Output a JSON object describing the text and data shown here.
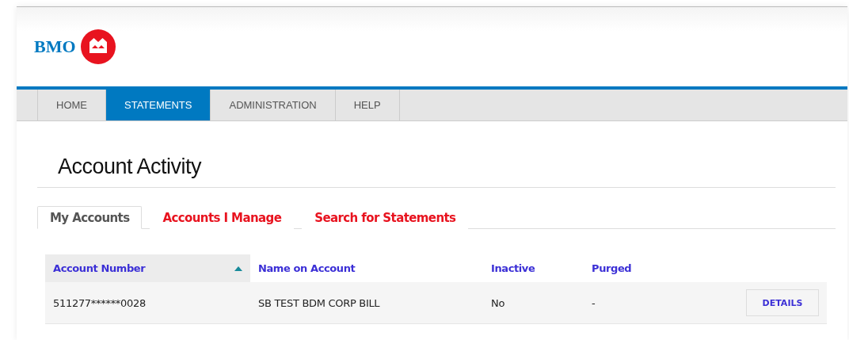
{
  "brand": {
    "name": "BMO"
  },
  "nav": [
    {
      "label": "HOME",
      "selected": false
    },
    {
      "label": "STATEMENTS",
      "selected": true
    },
    {
      "label": "ADMINISTRATION",
      "selected": false
    },
    {
      "label": "HELP",
      "selected": false
    }
  ],
  "page_title": "Account Activity",
  "tabs": [
    {
      "label": "My Accounts",
      "selected": true
    },
    {
      "label": "Accounts I Manage",
      "selected": false
    },
    {
      "label": "Search for Statements",
      "selected": false
    }
  ],
  "table": {
    "columns": [
      {
        "label": "Account Number",
        "sorted": true
      },
      {
        "label": "Name on Account",
        "sorted": false
      },
      {
        "label": "Inactive",
        "sorted": false
      },
      {
        "label": "Purged",
        "sorted": false
      }
    ],
    "rows": [
      {
        "cells": [
          "511277******0028",
          "SB TEST BDM CORP BILL",
          "No",
          "-"
        ],
        "action": "DETAILS"
      }
    ]
  }
}
